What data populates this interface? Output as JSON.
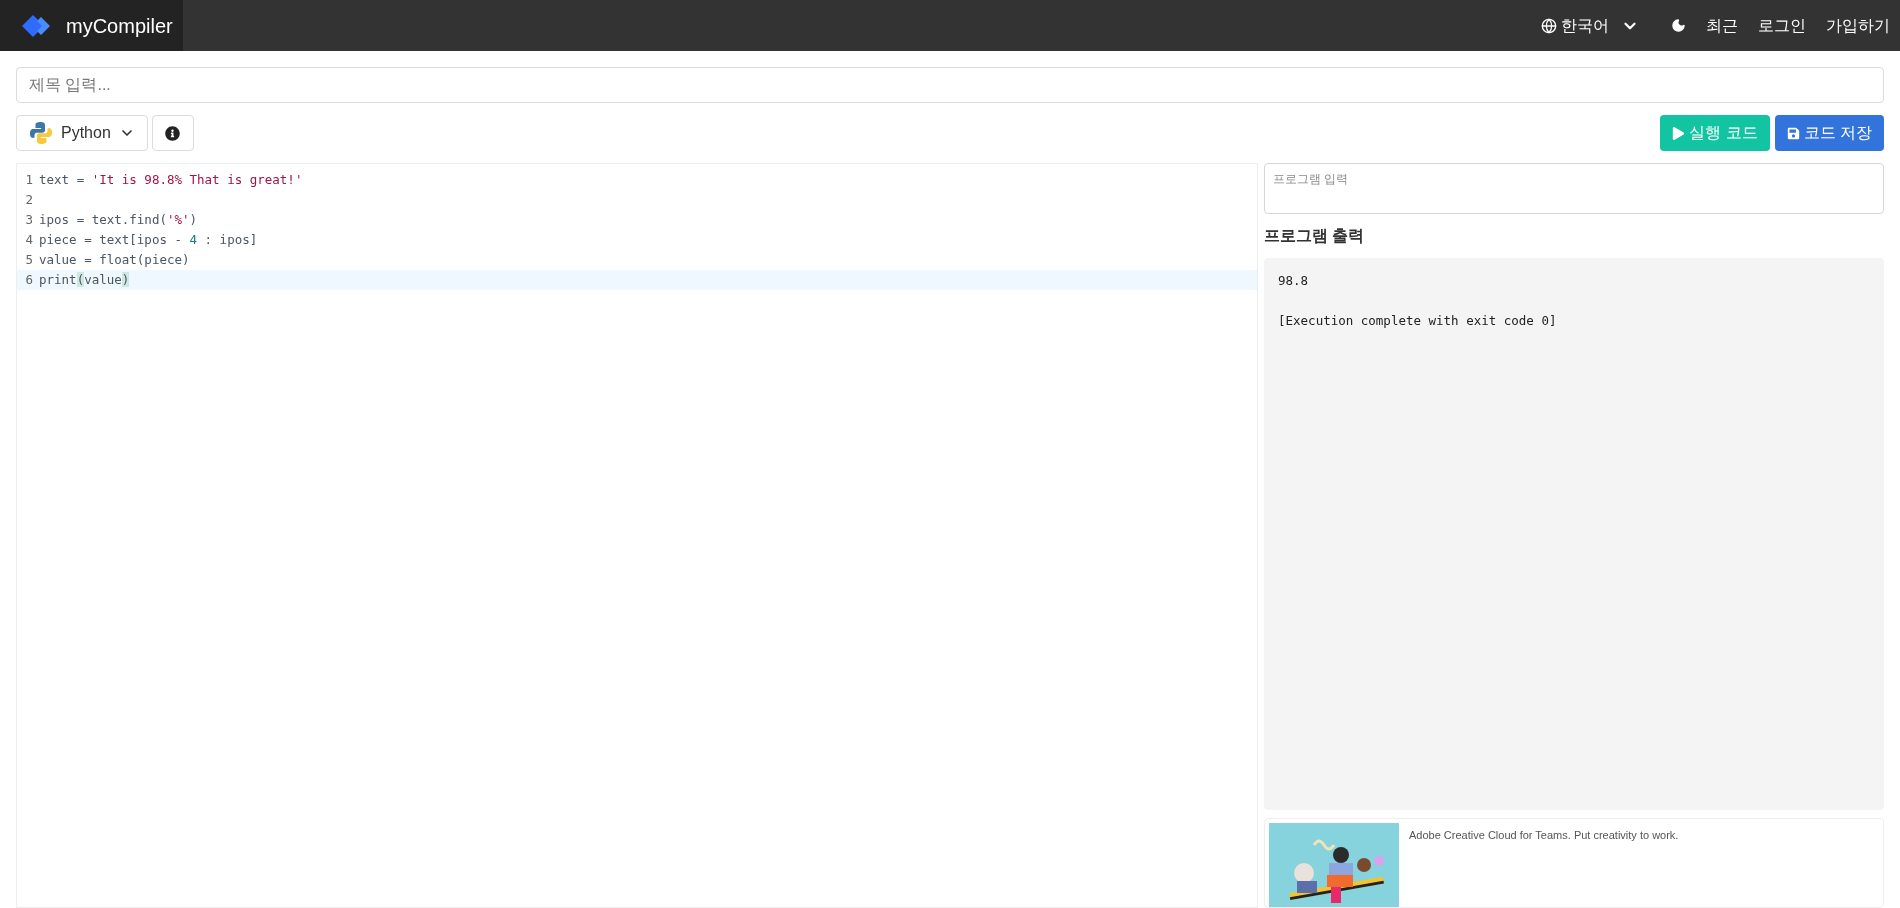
{
  "header": {
    "brand": "myCompiler",
    "language": "한국어",
    "links": [
      "최근",
      "로그인",
      "가입하기"
    ]
  },
  "title_field": {
    "placeholder": "제목 입력..."
  },
  "toolbar": {
    "language": "Python",
    "run_button": "실행 코드",
    "save_button": "코드 저장"
  },
  "editor": {
    "lines": [
      {
        "number": "1",
        "active": false,
        "tokens": [
          {
            "text": "text = ",
            "kind": "plain"
          },
          {
            "text": "'It is 98.8% That is great!'",
            "kind": "string"
          }
        ]
      },
      {
        "number": "2",
        "active": false
      },
      {
        "number": "3",
        "active": false,
        "tokens": [
          {
            "text": "ipos = text.find(",
            "kind": "plain"
          },
          {
            "text": "'%'",
            "kind": "string"
          },
          {
            "text": ")",
            "kind": "plain"
          }
        ]
      },
      {
        "number": "4",
        "active": false,
        "tokens": [
          {
            "text": "piece = text[ipos - ",
            "kind": "plain"
          },
          {
            "text": "4",
            "kind": "number"
          },
          {
            "text": " : ipos]",
            "kind": "plain"
          }
        ]
      },
      {
        "number": "5",
        "active": false,
        "tokens": [
          {
            "text": "value = float(piece)",
            "kind": "plain"
          }
        ]
      },
      {
        "number": "6",
        "active": true,
        "tokens": [
          {
            "text": "print",
            "kind": "plain"
          },
          {
            "text": "(",
            "kind": "bracket"
          },
          {
            "text": "value",
            "kind": "plain"
          },
          {
            "text": ")",
            "kind": "bracket"
          }
        ]
      }
    ]
  },
  "program_input": {
    "placeholder": "프로그램 입력"
  },
  "program_output": {
    "title": "프로그램 출력",
    "lines": [
      "98.8",
      "[Execution complete with exit code 0]"
    ]
  },
  "ad": {
    "text": "Adobe Creative Cloud for Teams. Put creativity to work."
  }
}
